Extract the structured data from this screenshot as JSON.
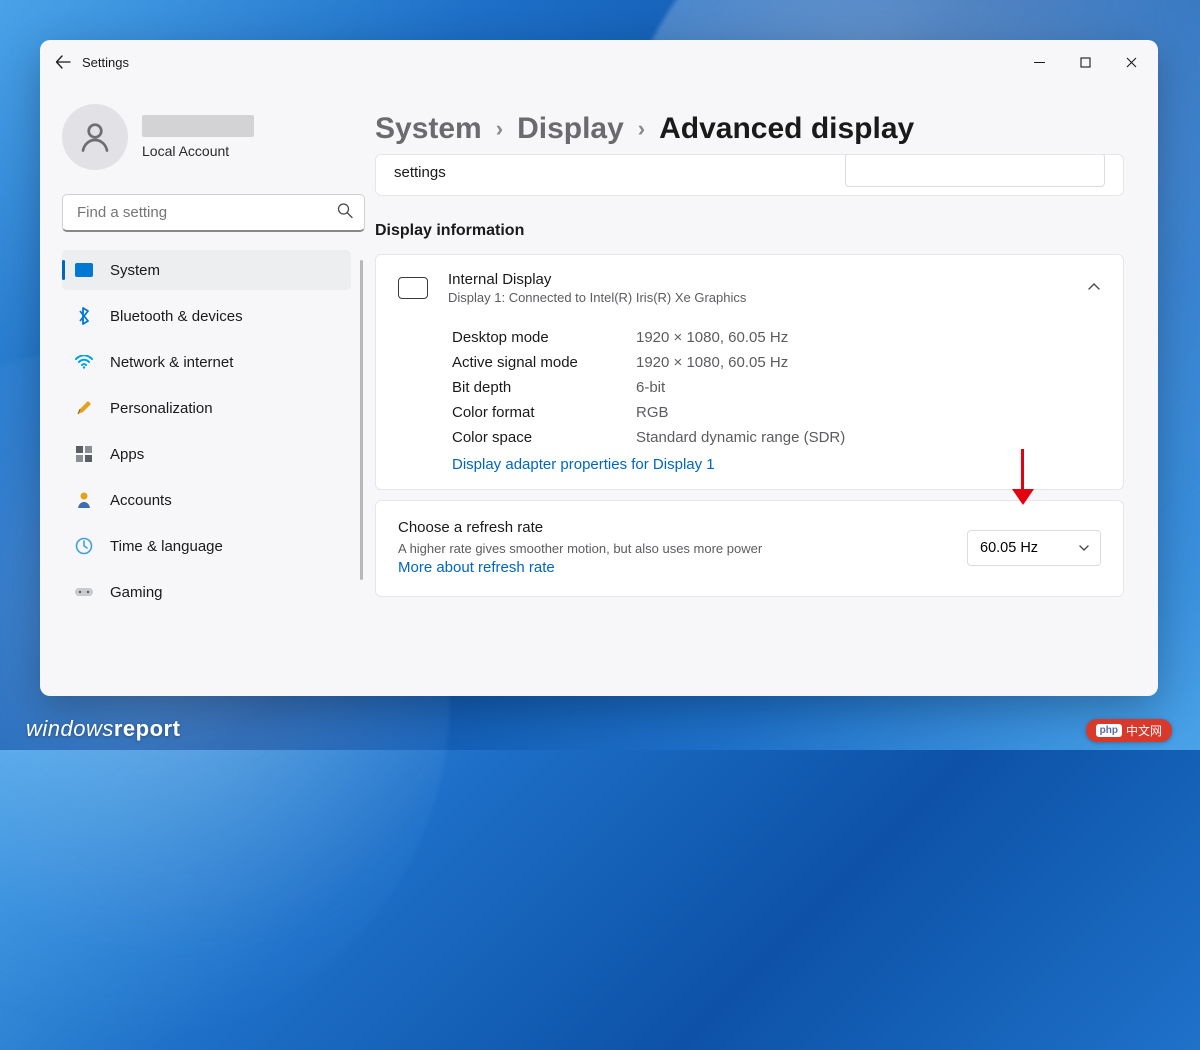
{
  "window": {
    "title": "Settings"
  },
  "account": {
    "subtitle": "Local Account"
  },
  "search": {
    "placeholder": "Find a setting"
  },
  "sidebar": {
    "items": [
      {
        "label": "System",
        "icon_color": "#0078d4",
        "active": true
      },
      {
        "label": "Bluetooth & devices",
        "icon_color": "#0078d4"
      },
      {
        "label": "Network & internet",
        "icon_color": "#00a2ed"
      },
      {
        "label": "Personalization",
        "icon_color": "#e3a21a"
      },
      {
        "label": "Apps",
        "icon_color": "#5a5e66"
      },
      {
        "label": "Accounts",
        "icon_color": "#e3a21a"
      },
      {
        "label": "Time & language",
        "icon_color": "#3ea2d9"
      },
      {
        "label": "Gaming",
        "icon_color": "#8a8e96"
      }
    ]
  },
  "breadcrumbs": {
    "a": "System",
    "b": "Display",
    "c": "Advanced display"
  },
  "stub_card": {
    "label": "settings"
  },
  "section": {
    "title": "Display information"
  },
  "display_card": {
    "title": "Internal Display",
    "subtitle": "Display 1: Connected to Intel(R) Iris(R) Xe Graphics",
    "rows": [
      {
        "k": "Desktop mode",
        "v": "1920 × 1080, 60.05 Hz"
      },
      {
        "k": "Active signal mode",
        "v": "1920 × 1080, 60.05 Hz"
      },
      {
        "k": "Bit depth",
        "v": "6-bit"
      },
      {
        "k": "Color format",
        "v": "RGB"
      },
      {
        "k": "Color space",
        "v": "Standard dynamic range (SDR)"
      }
    ],
    "adapter_link": "Display adapter properties for Display 1"
  },
  "refresh_card": {
    "title": "Choose a refresh rate",
    "desc_prefix": "A higher rate gives smoother motion, but also uses more power  ",
    "desc_link": "More about refresh rate",
    "selected": "60.05 Hz"
  },
  "watermark": {
    "a": "windows",
    "b": "report"
  },
  "stamp": {
    "text": "中文网"
  }
}
